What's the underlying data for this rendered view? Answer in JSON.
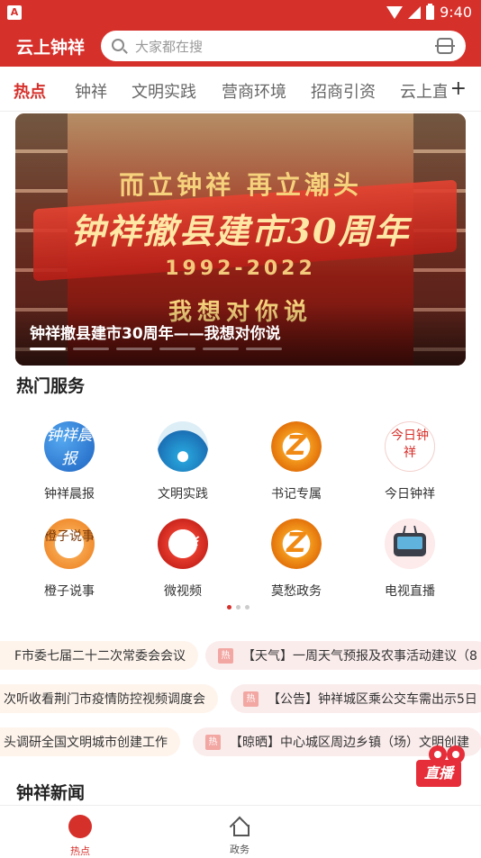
{
  "status_bar": {
    "carrier_icon": "A",
    "time": "9:40"
  },
  "header": {
    "app_title": "云上钟祥",
    "search_placeholder": "大家都在搜"
  },
  "tabs": [
    {
      "label": "热点",
      "active": true
    },
    {
      "label": "钟祥"
    },
    {
      "label": "文明实践"
    },
    {
      "label": "营商环境"
    },
    {
      "label": "招商引资"
    },
    {
      "label": "云上直"
    }
  ],
  "banner": {
    "line1": "而立钟祥 再立潮头",
    "line2": "钟祥撤县建市30周年",
    "line3": "1992-2022",
    "line4": "我想对你说",
    "caption": "钟祥撤县建市30周年——我想对你说",
    "slide_count": 6,
    "active_slide": 0
  },
  "hot_services": {
    "title": "热门服务",
    "items": [
      {
        "label": "钟祥晨报",
        "icon": "zhongxiang-morning-news-icon",
        "glyph": "钟祥晨报"
      },
      {
        "label": "文明实践",
        "icon": "civilization-practice-icon",
        "glyph": ""
      },
      {
        "label": "书记专属",
        "icon": "secretary-icon",
        "glyph": "Z"
      },
      {
        "label": "今日钟祥",
        "icon": "today-zhongxiang-icon",
        "glyph": "今日钟祥"
      },
      {
        "label": "橙子说事",
        "icon": "orange-talk-icon",
        "glyph": "橙子说事"
      },
      {
        "label": "微视频",
        "icon": "micro-video-icon",
        "glyph": "精彩"
      },
      {
        "label": "莫愁政务",
        "icon": "mochou-government-icon",
        "glyph": "Z"
      },
      {
        "label": "电视直播",
        "icon": "tv-live-icon",
        "glyph": ""
      }
    ],
    "page_count": 3,
    "active_page": 0
  },
  "ticker": {
    "hot_badge": "热",
    "rows": [
      [
        "F市委七届二十二次常委会会议",
        "【天气】一周天气预报及农事活动建议（8"
      ],
      [
        "次听收看荆门市疫情防控视频调度会",
        "【公告】钟祥城区乘公交车需出示5日"
      ],
      [
        "头调研全国文明城市创建工作",
        "【晾晒】中心城区周边乡镇（场）文明创建"
      ]
    ]
  },
  "news_section": {
    "title": "钟祥新闻"
  },
  "live_float": {
    "label": "直播"
  },
  "bottom_nav": [
    {
      "label": "热点",
      "icon": "hot-icon",
      "active": true
    },
    {
      "label": "政务",
      "icon": "home-icon"
    }
  ]
}
